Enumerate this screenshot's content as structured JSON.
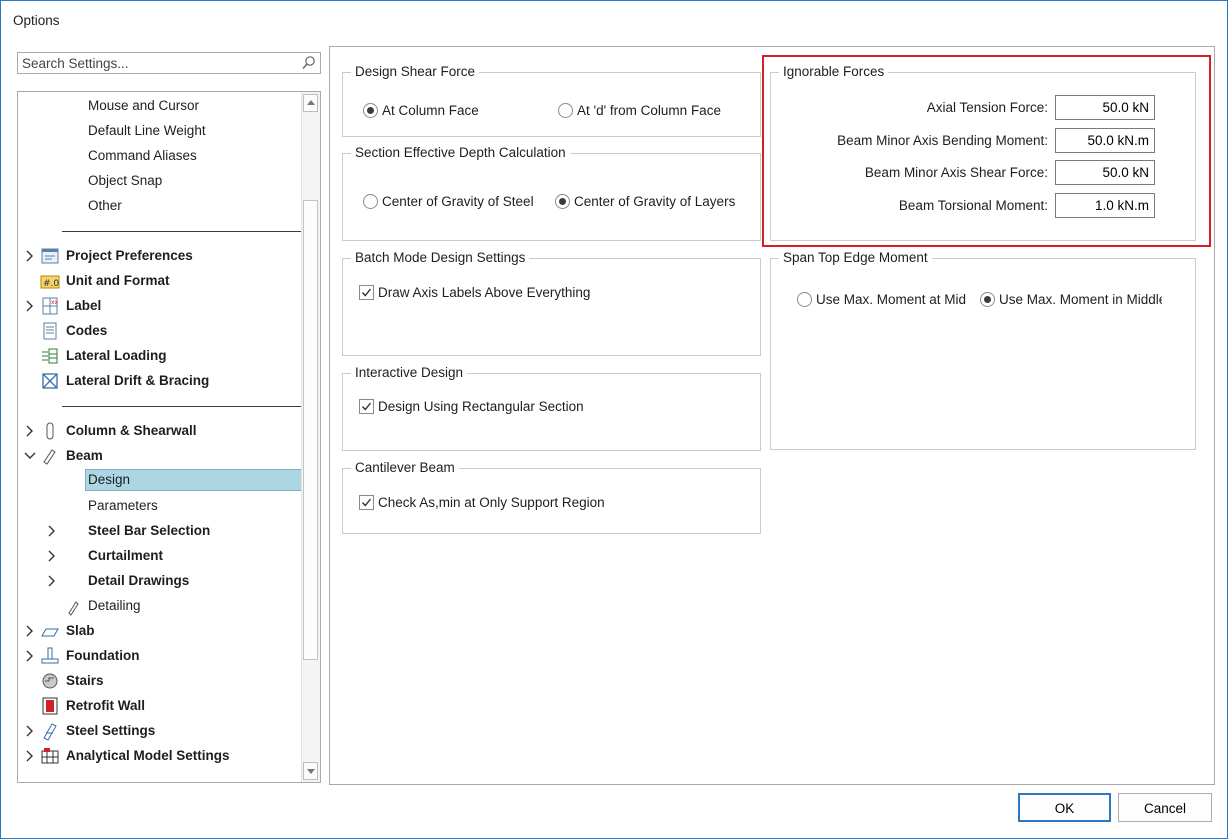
{
  "window": {
    "title": "Options"
  },
  "search": {
    "placeholder": "Search Settings..."
  },
  "tree": {
    "items": [
      {
        "label": "Mouse and Cursor"
      },
      {
        "label": "Default Line Weight"
      },
      {
        "label": "Command Aliases"
      },
      {
        "label": "Object Snap"
      },
      {
        "label": "Other"
      },
      {
        "label": "Project Preferences"
      },
      {
        "label": "Unit and Format"
      },
      {
        "label": "Label"
      },
      {
        "label": "Codes"
      },
      {
        "label": "Lateral Loading"
      },
      {
        "label": "Lateral Drift & Bracing"
      },
      {
        "label": "Column & Shearwall"
      },
      {
        "label": "Beam"
      },
      {
        "label": "Design"
      },
      {
        "label": "Parameters"
      },
      {
        "label": "Steel Bar Selection"
      },
      {
        "label": "Curtailment"
      },
      {
        "label": "Detail Drawings"
      },
      {
        "label": "Detailing"
      },
      {
        "label": "Slab"
      },
      {
        "label": "Foundation"
      },
      {
        "label": "Stairs"
      },
      {
        "label": "Retrofit Wall"
      },
      {
        "label": "Steel Settings"
      },
      {
        "label": "Analytical Model Settings"
      }
    ]
  },
  "design_shear_force": {
    "title": "Design Shear Force",
    "options": [
      "At Column Face",
      "At 'd' from Column Face"
    ],
    "selected": "At Column Face"
  },
  "section_depth": {
    "title": "Section Effective Depth Calculation",
    "options": [
      "Center of Gravity of Steel",
      "Center of Gravity of Layers"
    ],
    "selected": "Center of Gravity of Layers"
  },
  "batch_mode": {
    "title": "Batch Mode Design Settings",
    "checkbox": {
      "label": "Draw Axis Labels Above Everything",
      "checked": true
    }
  },
  "interactive_design": {
    "title": "Interactive Design",
    "checkbox": {
      "label": "Design Using Rectangular Section",
      "checked": true
    }
  },
  "cantilever_beam": {
    "title": "Cantilever Beam",
    "checkbox": {
      "label": "Check As,min at Only Support Region",
      "checked": true
    }
  },
  "ignorable_forces": {
    "title": "Ignorable Forces",
    "fields": [
      {
        "label": "Axial Tension Force:",
        "value": "50.0 kN"
      },
      {
        "label": "Beam Minor Axis Bending Moment:",
        "value": "50.0 kN.m"
      },
      {
        "label": "Beam Minor Axis Shear Force:",
        "value": "50.0 kN"
      },
      {
        "label": "Beam Torsional Moment:",
        "value": "1.0 kN.m"
      }
    ]
  },
  "span_top_edge": {
    "title": "Span Top Edge Moment",
    "options": [
      "Use Max. Moment at Mid",
      "Use Max. Moment in Middle"
    ],
    "selected": "Use Max. Moment in Middle"
  },
  "buttons": {
    "ok": "OK",
    "cancel": "Cancel"
  },
  "colors": {
    "accent": "#2b78c5",
    "selection": "#add6e4",
    "highlight": "#d1202a"
  }
}
